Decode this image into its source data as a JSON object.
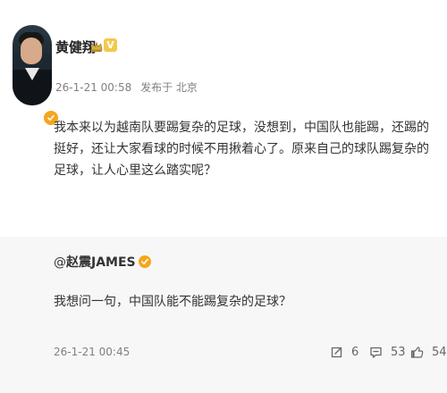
{
  "post": {
    "author": "黄健翔",
    "timestamp": "26-1-21 00:58",
    "location": "发布于 北京",
    "text": "我本来以为越南队要踢复杂的足球，没想到，中国队也能踢，还踢的挺好，还让大家看球的时候不用揪着心了。原来自己的球队踢复杂的足球，让人心里这么踏实呢？"
  },
  "reply": {
    "author_prefix": "@",
    "author": "赵震JAMES",
    "text": "我想问一句，中国队能不能踢复杂的足球？",
    "timestamp": "26-1-21 00:45",
    "actions": {
      "repost_count": "6",
      "comment_count": "53",
      "like_count": "54"
    }
  },
  "icons": {
    "crown": "crown-icon",
    "vip": "vip-icon",
    "verified": "verified-badge-icon",
    "repost": "repost-icon",
    "comment": "comment-icon",
    "like": "like-icon"
  },
  "colors": {
    "background": "#ffffff",
    "reply_background": "#f7f7f7",
    "text": "#333333",
    "meta": "#808080",
    "badge": "#f7a51c"
  }
}
